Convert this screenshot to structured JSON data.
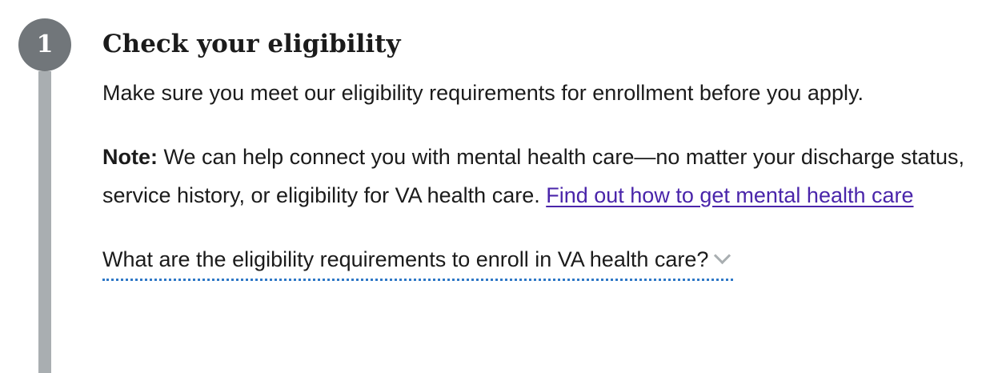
{
  "step": {
    "number": "1",
    "title": "Check your eligibility",
    "intro": "Make sure you meet our eligibility requirements for enrollment before you apply.",
    "note_label": "Note:",
    "note_text": " We can help connect you with mental health care—no matter your discharge status, service history, or eligibility for VA health care. ",
    "note_link": "Find out how to get mental health care",
    "accordion_label": "What are the eligibility requirements to enroll in VA health care?",
    "accordion_icon": "chevron-down-icon"
  },
  "colors": {
    "circle": "#71767a",
    "line": "#a9aeb1",
    "link": "#4a25aa",
    "dotted_underline": "#2e78c7"
  }
}
